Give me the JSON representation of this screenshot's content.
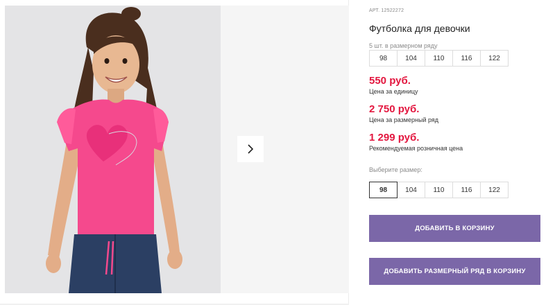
{
  "product": {
    "article": "АРТ. 12522272",
    "title": "Футболка для девочки",
    "size_row_label": "5 шт. в размерном ряду",
    "size_row": [
      "98",
      "104",
      "110",
      "116",
      "122"
    ],
    "prices": [
      {
        "value": "550 руб.",
        "caption": "Цена за единицу"
      },
      {
        "value": "2 750 руб.",
        "caption": "Цена за размерный ряд"
      },
      {
        "value": "1 299 руб.",
        "caption": "Рекомендуемая розничная цена"
      }
    ],
    "choose_label": "Выберите размер:",
    "choose_sizes": [
      "98",
      "104",
      "110",
      "116",
      "122"
    ],
    "selected_size": "98",
    "add_to_cart": "ДОБАВИТЬ В КОРЗИНУ",
    "add_row_to_cart": "ДОБАВИТЬ РАЗМЕРНЫЙ РЯД В КОРЗИНУ"
  },
  "gallery": {
    "next_icon": "chevron-right-icon"
  },
  "colors": {
    "price": "#e3173f",
    "button": "#7b67a8",
    "shirt": "#f5498d",
    "jeans": "#2b3f63"
  }
}
